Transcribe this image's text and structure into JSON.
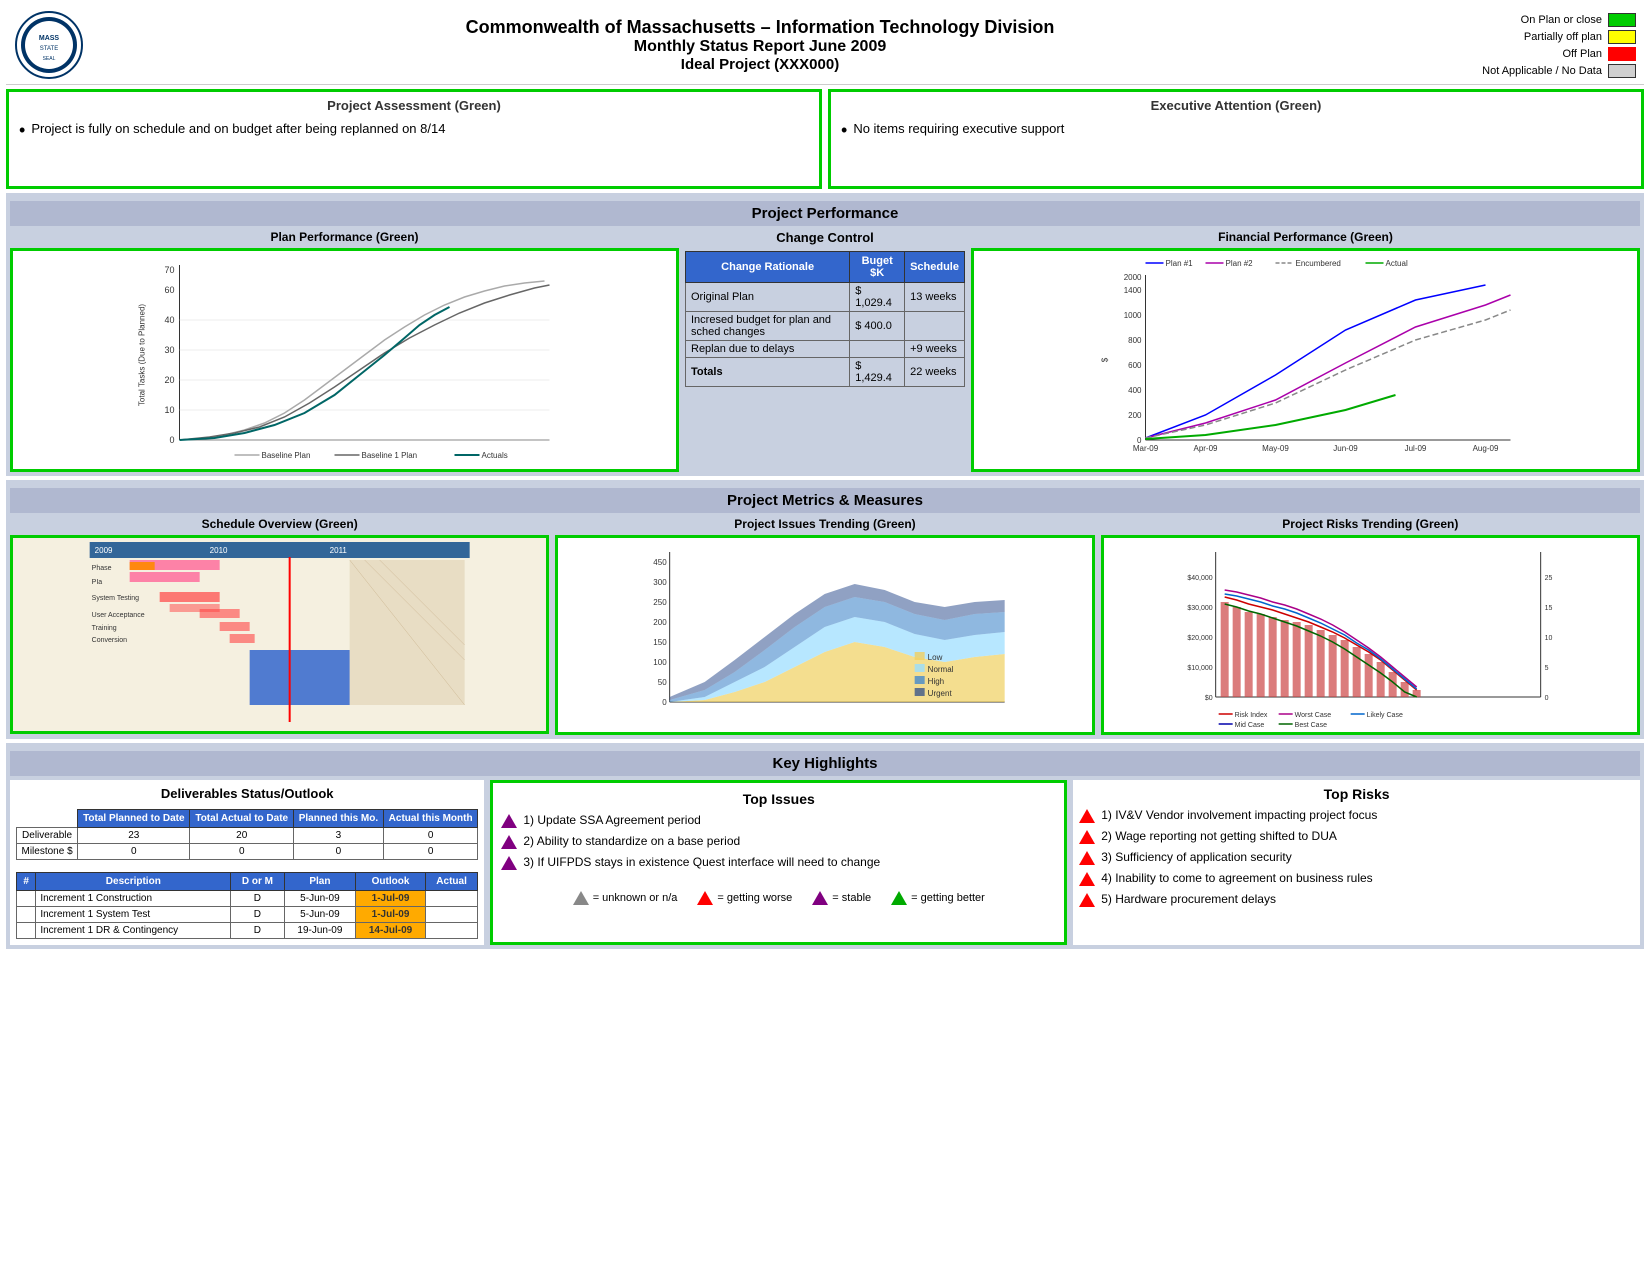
{
  "header": {
    "title1": "Commonwealth of Massachusetts – Information Technology Division",
    "title2": "Monthly Status Report June 2009",
    "title3": "Ideal Project (XXX000)"
  },
  "legend": {
    "items": [
      {
        "label": "On Plan or close",
        "color": "green"
      },
      {
        "label": "Partially off plan",
        "color": "yellow"
      },
      {
        "label": "Off Plan",
        "color": "red"
      },
      {
        "label": "Not Applicable / No Data",
        "color": "gray"
      }
    ]
  },
  "project_assessment": {
    "title": "Project Assessment (Green)",
    "text": "Project is fully on schedule and on budget after being replanned on 8/14"
  },
  "executive_attention": {
    "title": "Executive Attention (Green)",
    "text": "No items requiring executive support"
  },
  "performance_header": "Project Performance",
  "plan_performance": {
    "title": "Plan Performance (Green)",
    "y_label": "Total Tasks (Due to Planned)",
    "y_max": 70,
    "legend": [
      "Baseline Plan",
      "Baseline 1 Plan",
      "Actuals"
    ]
  },
  "change_control": {
    "title": "Change Control",
    "headers": [
      "Change Rationale",
      "Buget $K",
      "Schedule"
    ],
    "rows": [
      {
        "rationale": "Original Plan",
        "budget": "$ 1,029.4",
        "schedule": "13 weeks"
      },
      {
        "rationale": "Incresed budget for plan and sched changes",
        "budget": "$   400.0",
        "schedule": ""
      },
      {
        "rationale": "Replan due to delays",
        "budget": "",
        "schedule": "+9 weeks"
      },
      {
        "rationale": "Totals",
        "budget": "$ 1,429.4",
        "schedule": "22 weeks"
      }
    ]
  },
  "financial_performance": {
    "title": "Financial Performance (Green)",
    "legend": [
      "Plan #1",
      "Plan #2",
      "Encumbered",
      "Actual"
    ],
    "y_max": 2000,
    "x_labels": [
      "Mar-09",
      "Apr-09",
      "May-09",
      "Jun-09",
      "Jul-09",
      "Aug-09"
    ]
  },
  "metrics_header": "Project Metrics & Measures",
  "schedule_overview": {
    "title": "Schedule Overview (Green)"
  },
  "issues_trending": {
    "title": "Project Issues Trending (Green)",
    "legend": [
      "Low",
      "Normal",
      "High",
      "Urgent"
    ],
    "y_max": 450
  },
  "risks_trending": {
    "title": "Project Risks Trending (Green)",
    "legend": [
      "Risk Index",
      "Worst Case",
      "Likely Case",
      "Mid Case",
      "Best Case"
    ],
    "y_left_max": 40000,
    "y_right_max": 25
  },
  "highlights_header": "Key Highlights",
  "deliverables": {
    "title": "Deliverables Status/Outlook",
    "col_headers": [
      "Total Planned to Date",
      "Total Actual to Date",
      "Planned this Mo.",
      "Actual this Month"
    ],
    "rows": [
      {
        "name": "Deliverable",
        "planned": 23,
        "actual": 20,
        "planned_mo": 3,
        "actual_mo": 0
      },
      {
        "name": "Milestone $",
        "planned": 0,
        "actual": 0,
        "planned_mo": 0,
        "actual_mo": 0
      }
    ],
    "detail_headers": [
      "#",
      "Description",
      "D or M",
      "Plan",
      "Outlook",
      "Actual"
    ],
    "detail_rows": [
      {
        "num": "",
        "desc": "Increment 1 Construction",
        "dom": "D",
        "plan": "5-Jun-09",
        "outlook": "1-Jul-09",
        "actual": ""
      },
      {
        "num": "",
        "desc": "Increment 1 System Test",
        "dom": "D",
        "plan": "5-Jun-09",
        "outlook": "1-Jul-09",
        "actual": ""
      },
      {
        "num": "",
        "desc": "Increment 1 DR & Contingency",
        "dom": "D",
        "plan": "19-Jun-09",
        "outlook": "14-Jul-09",
        "actual": ""
      }
    ]
  },
  "top_issues": {
    "title": "Top Issues",
    "items": [
      {
        "num": 1,
        "text": "Update SSA Agreement period",
        "icon": "purple"
      },
      {
        "num": 2,
        "text": "Ability to standardize on a base period",
        "icon": "purple"
      },
      {
        "num": 3,
        "text": "If UIFPDS stays in existence Quest interface will need to change",
        "icon": "purple"
      }
    ]
  },
  "top_risks": {
    "title": "Top Risks",
    "items": [
      {
        "num": 1,
        "text": "IV&V Vendor involvement impacting project focus",
        "icon": "red"
      },
      {
        "num": 2,
        "text": "Wage reporting not getting shifted to DUA",
        "icon": "red"
      },
      {
        "num": 3,
        "text": "Sufficiency of application security",
        "icon": "red"
      },
      {
        "num": 4,
        "text": "Inability to come to agreement on business rules",
        "icon": "red"
      },
      {
        "num": 5,
        "text": "Hardware procurement delays",
        "icon": "red"
      }
    ]
  },
  "symbol_legend": [
    {
      "type": "gray",
      "label": "= unknown or n/a"
    },
    {
      "type": "red",
      "label": "= getting worse"
    },
    {
      "type": "purple",
      "label": "= stable"
    },
    {
      "type": "green",
      "label": "= getting better"
    }
  ]
}
